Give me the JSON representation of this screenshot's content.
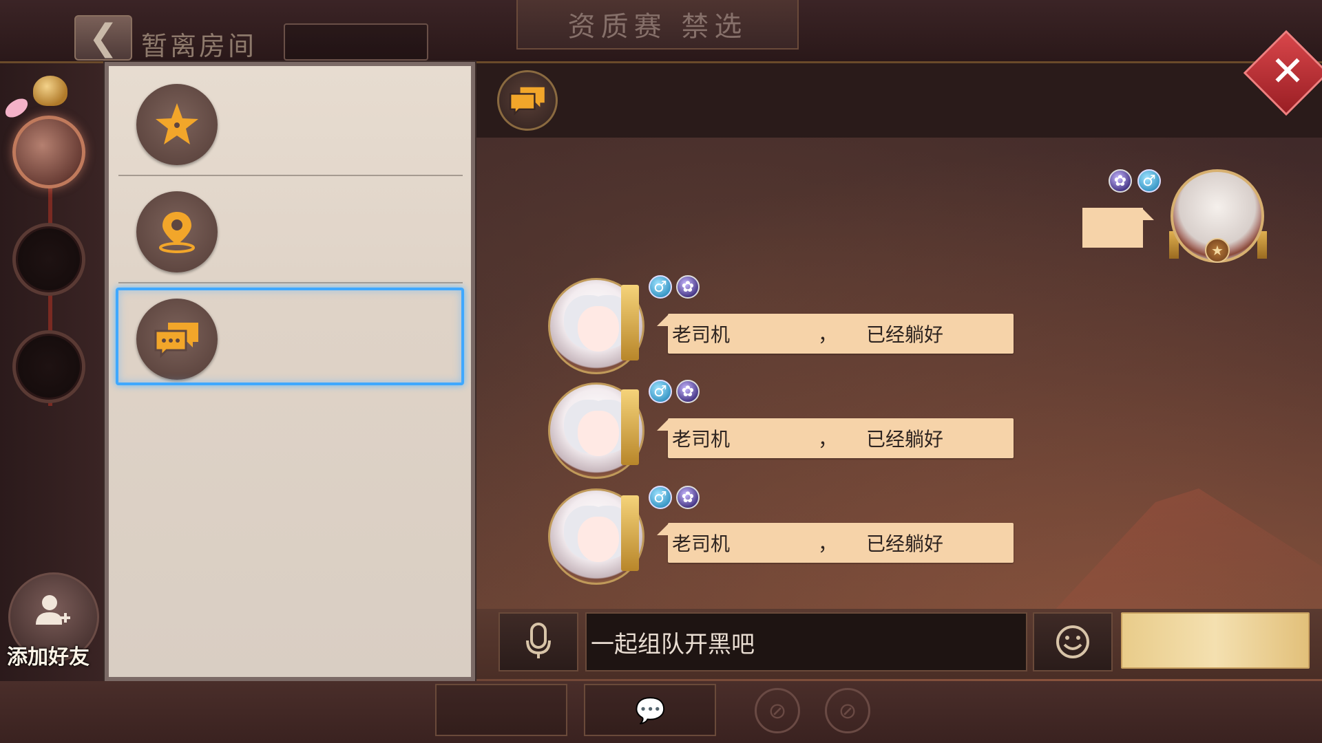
{
  "topbar": {
    "back_icon": "chevron-left-icon",
    "room_title": "暂离房间",
    "banner_title": "资质赛  禁选"
  },
  "sidebar": {
    "add_friend_label": "添加好友",
    "add_friend_icon": "add-user-icon"
  },
  "panel": {
    "items": [
      {
        "icon": "star-icon"
      },
      {
        "icon": "location-pin-icon"
      },
      {
        "icon": "chat-bubbles-icon",
        "selected": true
      }
    ]
  },
  "chat": {
    "header_icon": "chat-bubbles-icon",
    "messages": [
      {
        "part1": "老司机",
        "part2": "，",
        "part3": "已经躺好"
      },
      {
        "part1": "老司机",
        "part2": "，",
        "part3": "已经躺好"
      },
      {
        "part1": "老司机",
        "part2": "，",
        "part3": "已经躺好"
      }
    ]
  },
  "input": {
    "value": "一起组队开黑吧",
    "mic_icon": "microphone-icon",
    "emoji_icon": "smiley-icon"
  },
  "colors": {
    "accent_gold": "#e8a630",
    "bubble": "#f6d3a9",
    "selection": "#3fa8ff",
    "close_red": "#c8343a"
  }
}
